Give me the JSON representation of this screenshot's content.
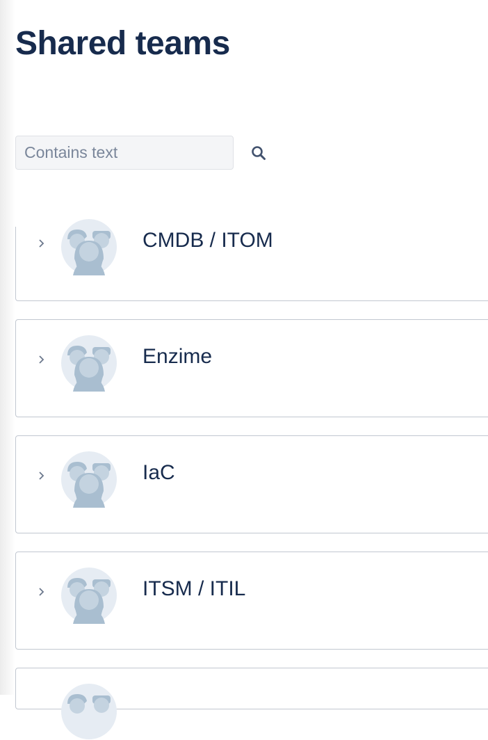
{
  "page": {
    "title": "Shared teams"
  },
  "search": {
    "placeholder": "Contains text",
    "value": ""
  },
  "icons": {
    "search": "search-icon",
    "expand": "chevron-right-icon",
    "team_avatar": "team-avatar-icon"
  },
  "colors": {
    "title": "#172b4d",
    "input_background": "#f4f5f7",
    "card_border": "#c1c7d0",
    "avatar_background": "#e6ecf3",
    "avatar_figure": "#a9bed0"
  },
  "teams": [
    {
      "name": "CMDB / ITOM"
    },
    {
      "name": "Enzime"
    },
    {
      "name": "IaC"
    },
    {
      "name": "ITSM / ITIL"
    },
    {
      "name": ""
    }
  ]
}
